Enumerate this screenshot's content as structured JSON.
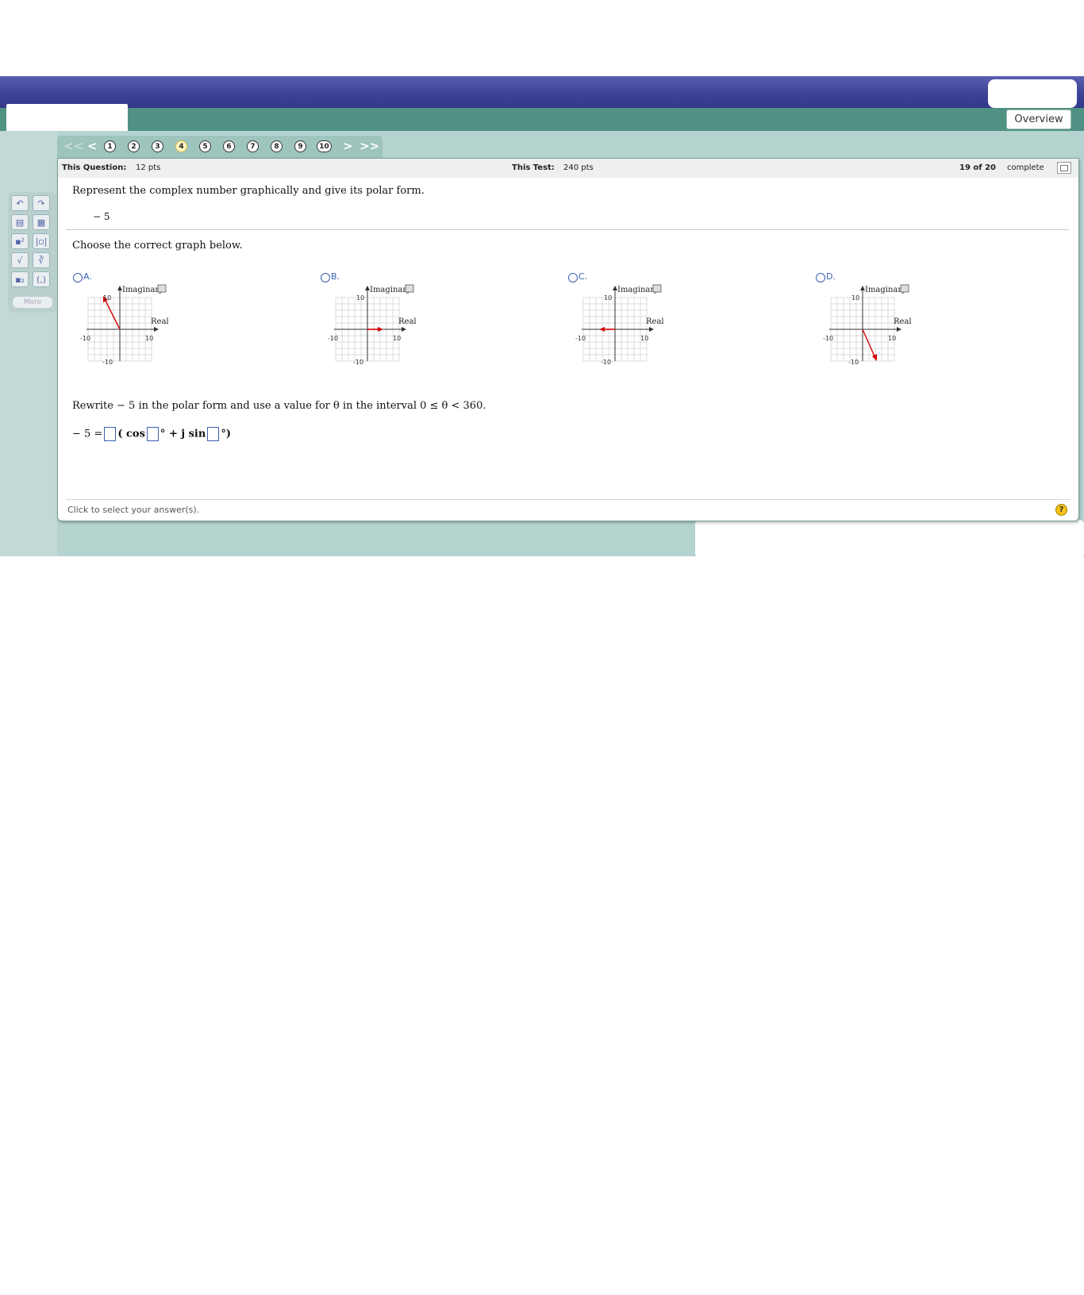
{
  "header": {
    "overview_label": "Overview"
  },
  "nav": {
    "first": "<<",
    "prev": "<",
    "next": ">",
    "last": ">>",
    "questions": [
      "1",
      "2",
      "3",
      "4",
      "5",
      "6",
      "7",
      "8",
      "9",
      "10"
    ],
    "current": "4"
  },
  "toolbar": {
    "more_label": "More"
  },
  "info": {
    "question_label": "This Question:",
    "question_pts": "12 pts",
    "test_label": "This Test:",
    "test_pts": "240 pts",
    "progress": "19 of 20",
    "progress_suffix": "complete"
  },
  "question": {
    "prompt": "Represent the complex number graphically and give its polar form.",
    "number": "− 5",
    "choose": "Choose the correct graph below.",
    "options": [
      {
        "label": "A.",
        "axis_imag": "Imaginary",
        "axis_real": "Real",
        "tick_top": "10",
        "tick_bottom": "-10",
        "tick_left": "-10",
        "tick_right": "10"
      },
      {
        "label": "B.",
        "axis_imag": "Imaginary",
        "axis_real": "Real",
        "tick_top": "10",
        "tick_bottom": "-10",
        "tick_left": "-10",
        "tick_right": "10"
      },
      {
        "label": "C.",
        "axis_imag": "Imaginary",
        "axis_real": "Real",
        "tick_top": "10",
        "tick_bottom": "-10",
        "tick_left": "-10",
        "tick_right": "10"
      },
      {
        "label": "D.",
        "axis_imag": "Imaginary",
        "axis_real": "Real",
        "tick_top": "10",
        "tick_bottom": "-10",
        "tick_left": "-10",
        "tick_right": "10"
      }
    ],
    "rewrite": "Rewrite  − 5 in the polar form and use a value for θ in the interval 0 ≤ θ < 360.",
    "eq_lhs": "− 5 =",
    "eq_open": "( cos",
    "eq_deg1": "° + j sin",
    "eq_deg2": "°)"
  },
  "footer": {
    "hint": "Click to select your answer(s).",
    "help": "?"
  },
  "colors": {
    "accent_blue": "#3a5fb0",
    "vector_red": "#d40000",
    "header_blue": "#3d4196",
    "header_green": "#4f9283"
  }
}
